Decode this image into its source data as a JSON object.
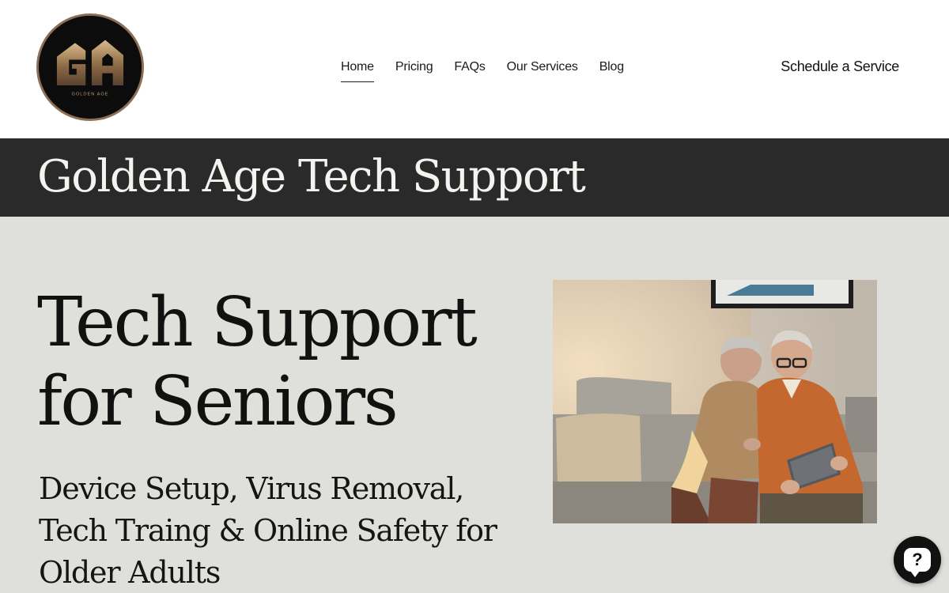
{
  "header": {
    "logo": {
      "monogram": "GA",
      "tagline": "GOLDEN AGE"
    },
    "nav": [
      {
        "label": "Home",
        "active": true
      },
      {
        "label": "Pricing",
        "active": false
      },
      {
        "label": "FAQs",
        "active": false
      },
      {
        "label": "Our Services",
        "active": false
      },
      {
        "label": "Blog",
        "active": false
      }
    ],
    "cta_label": "Schedule a Service"
  },
  "banner": {
    "site_title": "Golden Age Tech Support"
  },
  "hero": {
    "title_line1": "Tech Support",
    "title_line2": "for Seniors",
    "subtitle": "Device Setup, Virus Removal, Tech Traing & Online Safety for Older Adults",
    "photo_icon": "senior-couple-with-tablet-photo"
  },
  "help_widget": {
    "icon": "help-question-icon",
    "glyph": "?"
  },
  "colors": {
    "banner_bg": "#2a2a2a",
    "hero_bg": "#dfdfdb",
    "logo_gold": "#b08a5c"
  }
}
